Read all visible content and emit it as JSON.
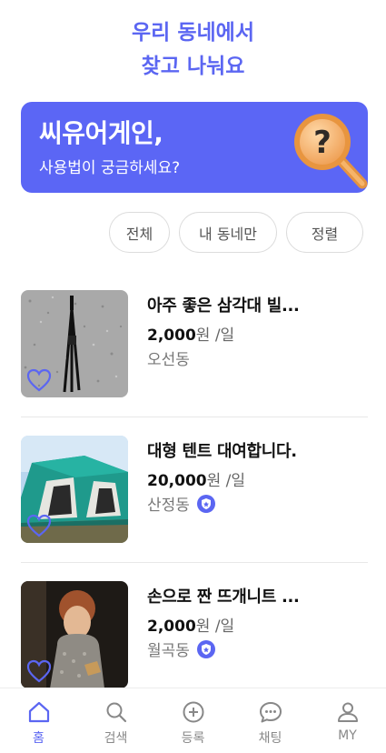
{
  "header": {
    "title_line1": "우리 동네에서",
    "title_line2": "찾고 나눠요"
  },
  "banner": {
    "title": "씨유어게인,",
    "subtitle": "사용법이 궁금하세요?",
    "icon": "magnifier-question-icon"
  },
  "filters": [
    {
      "label": "전체"
    },
    {
      "label": "내 동네만"
    },
    {
      "label": "정렬"
    }
  ],
  "items": [
    {
      "title": "아주 좋은 삼각대 빌...",
      "price": "2,000",
      "unit": "원 /일",
      "location": "오선동",
      "verified": false
    },
    {
      "title": "대형 텐트 대여합니다.",
      "price": "20,000",
      "unit": "원 /일",
      "location": "산정동",
      "verified": true
    },
    {
      "title": "손으로 짠 뜨개니트 ...",
      "price": "2,000",
      "unit": "원 /일",
      "location": "월곡동",
      "verified": true
    }
  ],
  "tabs": [
    {
      "label": "홈",
      "icon": "home-icon",
      "active": true
    },
    {
      "label": "검색",
      "icon": "search-icon",
      "active": false
    },
    {
      "label": "등록",
      "icon": "plus-circle-icon",
      "active": false
    },
    {
      "label": "채팅",
      "icon": "chat-icon",
      "active": false
    },
    {
      "label": "MY",
      "icon": "user-icon",
      "active": false
    }
  ],
  "colors": {
    "accent": "#5b66f2",
    "banner": "#5b66f5"
  }
}
